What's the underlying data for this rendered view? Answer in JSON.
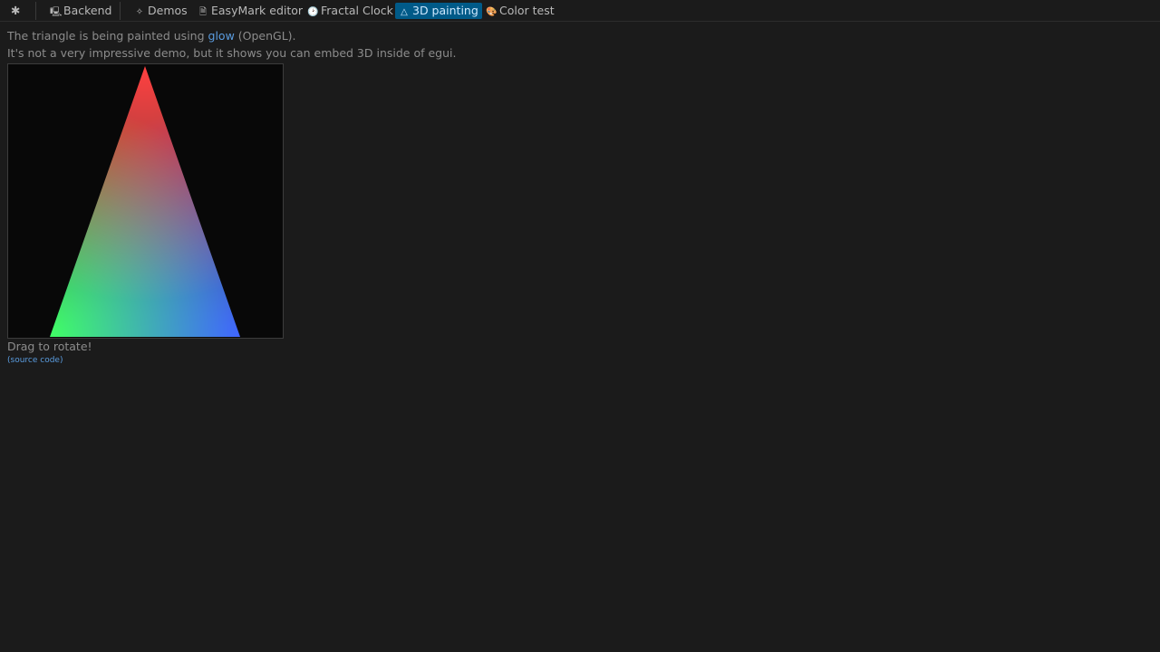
{
  "topbar": {
    "menu_icon": "✱",
    "tabs": [
      {
        "label": "Backend",
        "icon": "monitor-icon",
        "glyph": "🖳",
        "active": false
      },
      {
        "label": "Demos",
        "icon": "demos-icon",
        "glyph": "✧",
        "active": false
      },
      {
        "label": "EasyMark editor",
        "icon": "document-icon",
        "glyph": "🗎",
        "active": false
      },
      {
        "label": "Fractal Clock",
        "icon": "clock-icon",
        "glyph": "🕑",
        "active": false
      },
      {
        "label": "3D painting",
        "icon": "triangle-icon",
        "glyph": "△",
        "active": true
      },
      {
        "label": "Color test",
        "icon": "palette-icon",
        "glyph": "🎨",
        "active": false
      }
    ]
  },
  "content": {
    "line1_prefix": "The triangle is being painted using ",
    "line1_link": "glow",
    "line1_suffix": " (OpenGL).",
    "line2": "It's not a very impressive demo, but it shows you can embed 3D inside of egui.",
    "drag_hint": "Drag to rotate!",
    "source_link": "(source code)"
  },
  "colors": {
    "background": "#1b1b1b",
    "accent_tab": "#005a88",
    "link": "#5a9cdf",
    "canvas_bg": "#080808",
    "vertex_top": "#ff0000",
    "vertex_left": "#00ff00",
    "vertex_right": "#0000ff"
  }
}
